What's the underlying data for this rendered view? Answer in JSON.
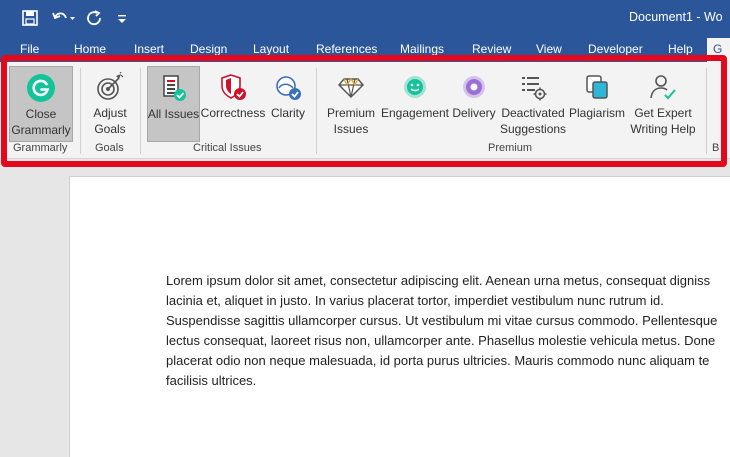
{
  "window": {
    "title": "Document1 - Wo"
  },
  "quick_access": {
    "save_icon": "save-icon",
    "undo_icon": "undo-icon",
    "redo_icon": "redo-icon",
    "customize_icon": "customize-icon"
  },
  "menu": {
    "tabs": [
      "File",
      "Home",
      "Insert",
      "Design",
      "Layout",
      "References",
      "Mailings",
      "Review",
      "View",
      "Developer",
      "Help"
    ],
    "active_tab": "G"
  },
  "ribbon": {
    "buttons": {
      "close_grammarly": "Close Grammarly",
      "adjust_goals": "Adjust Goals",
      "all_issues": "All Issues",
      "correctness": "Correctness",
      "clarity": "Clarity",
      "premium_issues": "Premium Issues",
      "engagement": "Engagement",
      "delivery": "Delivery",
      "deactivated_suggestions": "Deactivated Suggestions",
      "plagiarism": "Plagiarism",
      "get_expert": "Get Expert Writing Help"
    },
    "groups": {
      "grammarly": "Grammarly",
      "goals": "Goals",
      "critical_issues": "Critical Issues",
      "premium": "Premium",
      "trailing": "B"
    }
  },
  "document": {
    "lines": [
      "Lorem ipsum dolor sit amet, consectetur adipiscing elit. Aenean urna metus, consequat digniss",
      "lacinia et, aliquet in justo. In varius placerat tortor, imperdiet vestibulum nunc rutrum id.",
      "Suspendisse sagittis ullamcorper cursus. Ut vestibulum mi vitae cursus commodo. Pellentesque",
      "lectus consequat, laoreet risus non, ullamcorper ante. Phasellus molestie vehicula metus. Done",
      "placerat odio non neque malesuada, id porta purus ultricies. Mauris commodo nunc aliquam te",
      "facilisis ultrices."
    ]
  },
  "colors": {
    "title_bar": "#2b579a",
    "highlight": "#e3081c",
    "grammarly_green": "#15c39a"
  }
}
